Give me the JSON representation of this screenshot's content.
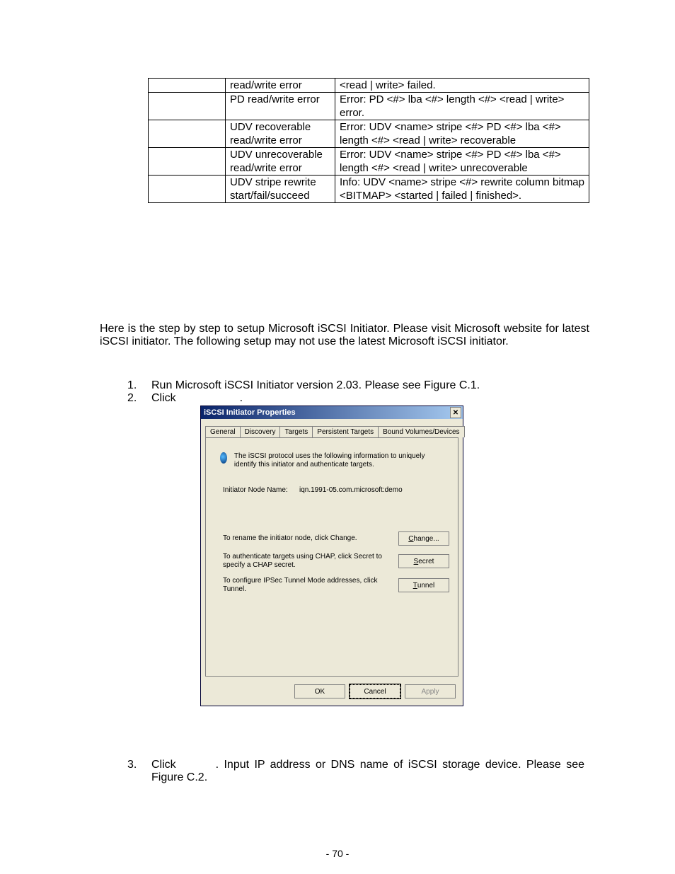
{
  "table": {
    "rows": [
      {
        "c1": "",
        "c2": "read/write error",
        "c3": "<read | write> failed."
      },
      {
        "c1": "",
        "c2": "PD read/write error",
        "c3": "Error: PD <#> lba <#> length <#> <read | write> error."
      },
      {
        "c1": "",
        "c2": "UDV recoverable read/write error",
        "c3": "Error: UDV <name> stripe <#> PD <#> lba <#> length <#> <read | write> recoverable"
      },
      {
        "c1": "",
        "c2": "UDV unrecoverable read/write error",
        "c3": "Error: UDV <name> stripe <#> PD <#> lba <#> length <#> <read | write> unrecoverable"
      },
      {
        "c1": "",
        "c2": "UDV stripe rewrite start/fail/succeed",
        "c3": "Info: UDV <name> stripe <#> rewrite column bitmap <BITMAP> <started | failed | finished>."
      }
    ]
  },
  "para1": "Here is the step by step to setup Microsoft iSCSI Initiator. Please visit Microsoft website for latest iSCSI initiator. The following setup may not use the latest Microsoft iSCSI initiator.",
  "steps": {
    "n1": "1.",
    "t1": "Run Microsoft iSCSI Initiator version 2.03. Please see Figure C.1.",
    "n2": "2.",
    "t2": "Click",
    "t2b": ".",
    "n3": "3.",
    "t3a": "Click",
    "t3b": ". Input IP address or DNS name of iSCSI storage device. Please see Figure C.2."
  },
  "dialog": {
    "title": "iSCSI Initiator Properties",
    "tabs": [
      "General",
      "Discovery",
      "Targets",
      "Persistent Targets",
      "Bound Volumes/Devices"
    ],
    "blurb": "The iSCSI protocol uses the following information to uniquely identify this initiator and authenticate targets.",
    "nodeLabel": "Initiator Node Name:",
    "nodeValue": "iqn.1991-05.com.microsoft:demo",
    "r1": "To rename the initiator node, click Change.",
    "r2": "To authenticate targets using CHAP, click Secret to specify a CHAP secret.",
    "r3": "To configure IPSec Tunnel Mode addresses, click Tunnel.",
    "btn_change": "hange...",
    "btn_secret": "ecret",
    "btn_tunnel": "unnel",
    "btn_ok": "OK",
    "btn_cancel": "Cancel",
    "btn_apply": "Apply"
  },
  "pagenum": "- 70 -"
}
